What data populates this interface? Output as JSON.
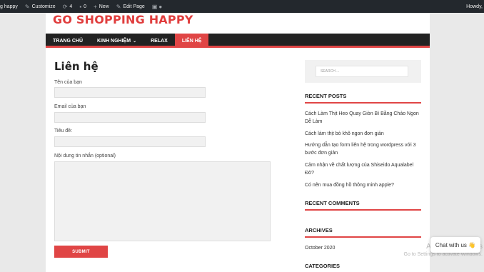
{
  "adminbar": {
    "site_name": "g happy",
    "customize": "Customize",
    "updates": "4",
    "comments": "0",
    "new": "New",
    "edit_page": "Edit Page",
    "howdy": "Howdy,"
  },
  "site": {
    "title": "GO SHOPPING HAPPY"
  },
  "nav": {
    "items": [
      {
        "label": "TRANG CHỦ"
      },
      {
        "label": "KINH NGHIỆM"
      },
      {
        "label": "RELAX"
      },
      {
        "label": "LIÊN HỆ",
        "active": true
      }
    ]
  },
  "form": {
    "title": "Liên hệ",
    "name_label": "Tên của bạn",
    "email_label": "Email của bạn",
    "subject_label": "Tiêu đề:",
    "message_label": "Nội dung tin nhắn (optional)",
    "submit_label": "SUBMIT"
  },
  "sidebar": {
    "search_placeholder": "SEARCH ...",
    "recent_posts_title": "RECENT POSTS",
    "recent_posts": [
      "Cách Làm Thịt Heo Quay Giòn Bì Bằng Chảo Ngon Dễ Làm",
      "Cách làm thịt bò khô ngon đơn giản",
      "Hướng dẫn tạo form liên hệ trong wordpress với 3 bước đơn giản",
      "Cảm nhận về chất lượng của Shiseido Aqualabel Đỏ?",
      "Có nên mua đồng hồ thông minh apple?"
    ],
    "recent_comments_title": "RECENT COMMENTS",
    "archives_title": "ARCHIVES",
    "archive_item": "October 2020",
    "categories_title": "CATEGORIES"
  },
  "overlay": {
    "activate_line1": "Activate Windows",
    "activate_line2": "Go to Settings to activate Windows.",
    "chat_label": "Chat with us 👋"
  },
  "colors": {
    "accent": "#e04545",
    "nav_bg": "#222222",
    "adminbar_bg": "#23282d"
  }
}
